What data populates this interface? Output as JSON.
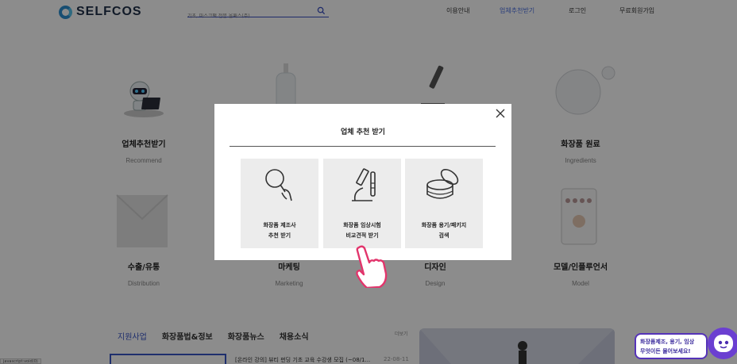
{
  "header": {
    "logo": "SELFCOS",
    "search_placeholder": "기초, 마스크팩 전문 올패스(주)",
    "nav": [
      "이용안내",
      "업체추천받기",
      "로그인",
      "무료회원가입"
    ],
    "active_nav": "업체추천받기"
  },
  "categories": [
    {
      "title": "업체추천받기",
      "subtitle": "Recommend"
    },
    {
      "title": "화장품 원료",
      "subtitle": "Ingredients"
    },
    {
      "title": "수출/유통",
      "subtitle": "Distribution"
    },
    {
      "title": "마케팅",
      "subtitle": "Marketing"
    },
    {
      "title": "디자인",
      "subtitle": "Design"
    },
    {
      "title": "모델/인플루언서",
      "subtitle": "Model"
    }
  ],
  "tabs": [
    "지원사업",
    "화장품법&정보",
    "화장품뉴스",
    "채용소식"
  ],
  "more_link": "더보기",
  "news": {
    "title": "[온라인 강의] 뷰티 펀딩 기초 교육 수강생 모집 (~08/1...",
    "date": "22-08-11"
  },
  "status_bar_url": "javascript:void(0)",
  "modal": {
    "title": "업체 추천 받기",
    "options": [
      {
        "label": "화장품 제조사\n추천 받기",
        "icon": "magnifier-hand-icon"
      },
      {
        "label": "화장품 임상시험\n비교견적 받기",
        "icon": "microscope-icon"
      },
      {
        "label": "화장품 용기/패키지\n검색",
        "icon": "cosmetic-jar-icon"
      }
    ]
  },
  "chat": {
    "line1": "화장품제조, 용기, 임상",
    "line2": "무엇이든 물어보세요!"
  },
  "colors": {
    "accent": "#3a56c7",
    "chat": "#5533b8",
    "overlay": "rgba(0,0,0,0.45)"
  }
}
